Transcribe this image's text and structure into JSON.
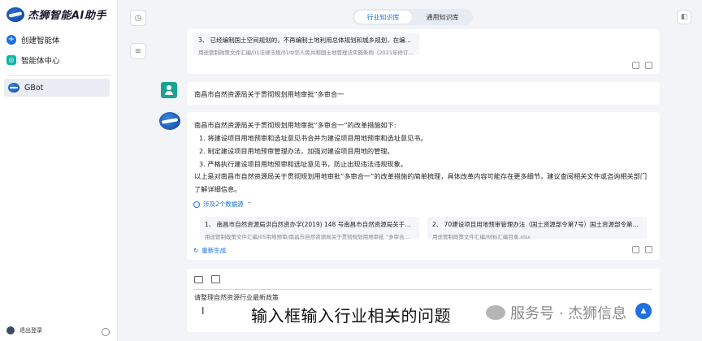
{
  "app": {
    "logo_text": "杰狮智能AI助手"
  },
  "sidebar": {
    "items": [
      {
        "label": "创建智能体",
        "icon": "plus-icon"
      },
      {
        "label": "智能体中心",
        "icon": "agent-hub-icon"
      }
    ],
    "active_bot": "GBot",
    "logout_label": "退出登录"
  },
  "tabs": [
    {
      "label": "行业知识库",
      "active": true
    },
    {
      "label": "通用知识库",
      "active": false
    }
  ],
  "prev_source": {
    "title": "3、 已经编制国土空间规划的，不再编制土地利用总体规划和城乡规划，在编制...",
    "path": "用途管制政策文件汇编/01法律法规/01中华人民共和国土地管理法实施条例（2021年修订..."
  },
  "user_message": "南昌市自然资源局关于贯彻规划用地审批“多审合一",
  "bot_message": {
    "intro": "南昌市自然资源局关于贯彻规划用地审批“多审合一”的改革措施如下:",
    "points": [
      "1. 将建设项目用地预审和选址意见书合并为建设项目用地预审和选址意见书。",
      "2. 制定建设项目用地预审管理办法，加强对建设项目用地的管理。",
      "3. 严格执行建设项目用地预审和选址意见书，防止出现违法违规现象。"
    ],
    "summary_line1": "以上是对南昌市自然资源局关于贯彻规划用地审批“多审合一”的改革措施的简单梳理，具体改革内容可能存在更多细节，建议查阅相关文件或咨询相关部门",
    "summary_line2": "了解详细信息。",
    "sources_label": "涉及2个数据源",
    "sources": [
      {
        "title": "1、 南昌市自然资源局洪自然资办字(2019) 148 号南昌市自然资源局关于贯彻...",
        "path": "用途管制政策文件汇编/05用地预审/南昌市自然资源局关于贯彻规划用地审批 “多审合一..."
      },
      {
        "title": "2、 70建设项目用地预审管理办法（国土资源部令第7号）国土资源部令第7号4...",
        "path": "用途管制政策文件汇编/材料汇编目录.xlsx"
      }
    ],
    "regenerate_label": "重新生成"
  },
  "input": {
    "value": "请整理自然资源行业最新政策",
    "caption": "输入框输入行业相关的问题"
  },
  "watermark": "服务号 · 杰狮信息",
  "colors": {
    "accent": "#1e6fe0",
    "teal": "#1aa394"
  }
}
